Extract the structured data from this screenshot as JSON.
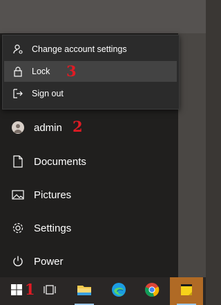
{
  "account_menu": {
    "items": [
      {
        "label": "Change account settings",
        "icon": "user-settings-icon"
      },
      {
        "label": "Lock",
        "icon": "lock-icon"
      },
      {
        "label": "Sign out",
        "icon": "sign-out-icon"
      }
    ]
  },
  "start_menu": {
    "user": {
      "label": "admin",
      "icon": "avatar-icon"
    },
    "items": [
      {
        "label": "Documents",
        "icon": "document-icon"
      },
      {
        "label": "Pictures",
        "icon": "picture-icon"
      },
      {
        "label": "Settings",
        "icon": "gear-icon"
      },
      {
        "label": "Power",
        "icon": "power-icon"
      }
    ]
  },
  "annotations": {
    "step1": "1",
    "step2": "2",
    "step3": "3"
  },
  "taskbar": {
    "items": [
      "windows-logo-icon",
      "task-view-icon",
      "file-explorer-icon",
      "edge-icon",
      "chrome-icon",
      "sticky-notes-icon"
    ]
  },
  "colors": {
    "accent_red": "#e01b24",
    "highlight": "#434343",
    "sticky_bg": "#b06a25"
  }
}
